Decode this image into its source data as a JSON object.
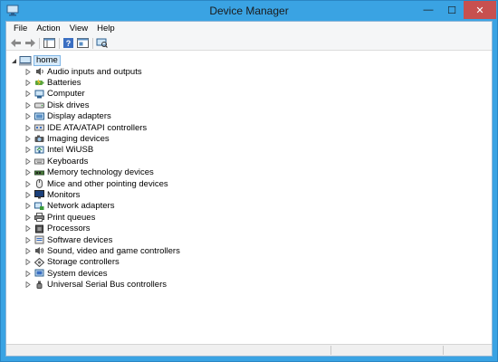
{
  "window": {
    "title": "Device Manager",
    "minimize_glyph": "—",
    "maximize_glyph": "☐",
    "close_glyph": "✕",
    "accent_color": "#3aa3e3",
    "close_color": "#c7504f"
  },
  "menu": [
    "File",
    "Action",
    "View",
    "Help"
  ],
  "toolbar": {
    "buttons": [
      "back-icon",
      "forward-icon",
      "properties-icon",
      "help-icon",
      "show-hide-console-tree-icon",
      "scan-hardware-icon"
    ]
  },
  "tree": {
    "root": "home",
    "categories": [
      {
        "label": "Audio inputs and outputs",
        "icon": "audio-icon"
      },
      {
        "label": "Batteries",
        "icon": "battery-icon"
      },
      {
        "label": "Computer",
        "icon": "computer-icon"
      },
      {
        "label": "Disk drives",
        "icon": "disk-drive-icon"
      },
      {
        "label": "Display adapters",
        "icon": "display-adapter-icon"
      },
      {
        "label": "IDE ATA/ATAPI controllers",
        "icon": "ide-controller-icon"
      },
      {
        "label": "Imaging devices",
        "icon": "camera-icon"
      },
      {
        "label": "Intel WiUSB",
        "icon": "wiusb-icon"
      },
      {
        "label": "Keyboards",
        "icon": "keyboard-icon"
      },
      {
        "label": "Memory technology devices",
        "icon": "memory-icon"
      },
      {
        "label": "Mice and other pointing devices",
        "icon": "mouse-icon"
      },
      {
        "label": "Monitors",
        "icon": "monitor-icon"
      },
      {
        "label": "Network adapters",
        "icon": "network-adapter-icon"
      },
      {
        "label": "Print queues",
        "icon": "printer-icon"
      },
      {
        "label": "Processors",
        "icon": "processor-icon"
      },
      {
        "label": "Software devices",
        "icon": "software-device-icon"
      },
      {
        "label": "Sound, video and game controllers",
        "icon": "sound-controller-icon"
      },
      {
        "label": "Storage controllers",
        "icon": "storage-controller-icon"
      },
      {
        "label": "System devices",
        "icon": "system-device-icon"
      },
      {
        "label": "Universal Serial Bus controllers",
        "icon": "usb-icon"
      }
    ]
  }
}
